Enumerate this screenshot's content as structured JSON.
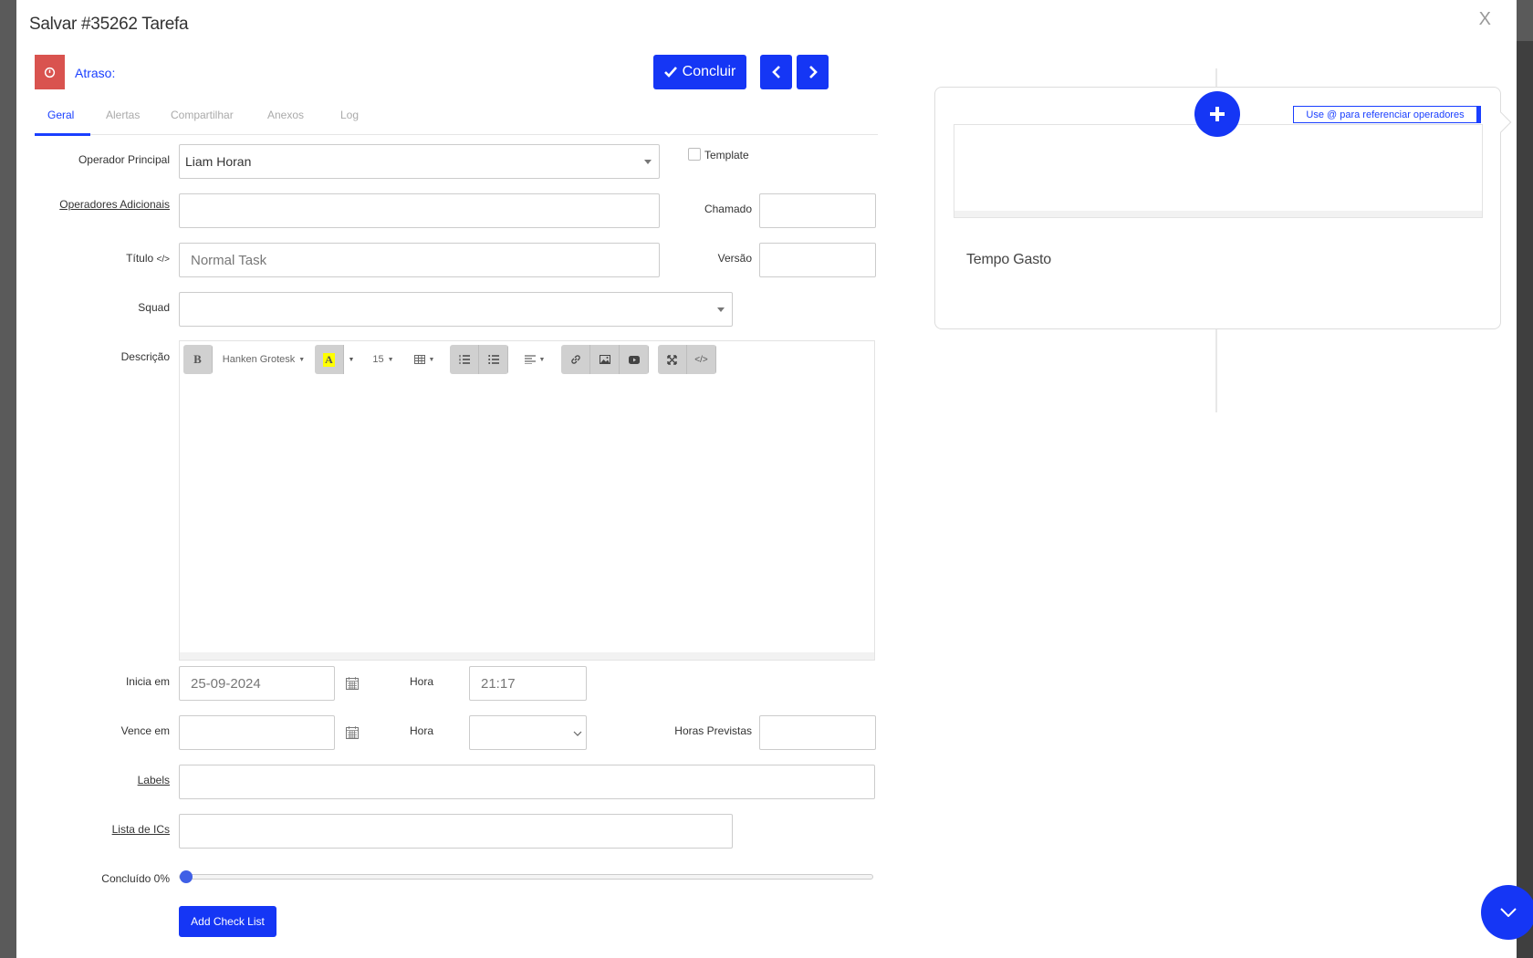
{
  "modal": {
    "title": "Salvar #35262 Tarefa",
    "close_label": "X"
  },
  "header": {
    "delay_label": "Atraso:",
    "conclude_label": "Concluir"
  },
  "tabs": [
    {
      "label": "Geral",
      "active": true
    },
    {
      "label": "Alertas",
      "active": false
    },
    {
      "label": "Compartilhar",
      "active": false
    },
    {
      "label": "Anexos",
      "active": false
    },
    {
      "label": "Log",
      "active": false
    }
  ],
  "form": {
    "main_operator": {
      "label": "Operador Principal",
      "value": "Liam Horan"
    },
    "template": {
      "label": "Template",
      "checked": false
    },
    "additional_operators": {
      "label": "Operadores Adicionais",
      "value": ""
    },
    "ticket": {
      "label": "Chamado",
      "value": ""
    },
    "title": {
      "label": "Título",
      "value": "Normal Task"
    },
    "version": {
      "label": "Versão",
      "value": ""
    },
    "squad": {
      "label": "Squad",
      "value": ""
    },
    "description": {
      "label": "Descrição",
      "value": ""
    },
    "starts_at": {
      "label": "Inicia em",
      "value": "25-09-2024"
    },
    "start_time": {
      "label": "Hora",
      "value": "21:17"
    },
    "due_at": {
      "label": "Vence em",
      "value": ""
    },
    "due_time": {
      "label": "Hora",
      "value": ""
    },
    "expected_hours": {
      "label": "Horas Previstas",
      "value": ""
    },
    "labels": {
      "label": "Labels",
      "value": ""
    },
    "ic_list": {
      "label": "Lista de ICs",
      "value": ""
    },
    "completed": {
      "label": "Concluído 0%",
      "percent": 0
    },
    "add_checklist_label": "Add Check List"
  },
  "editor_toolbar": {
    "bold": "B",
    "font_name": "Hanken Grotesk",
    "font_color": "A",
    "font_size": "15"
  },
  "comment_panel": {
    "mention_hint": "Use @ para referenciar operadores",
    "time_spent_label": "Tempo Gasto"
  },
  "colors": {
    "primary": "#1536f5",
    "danger": "#d9534f",
    "link": "#1a3fff"
  }
}
